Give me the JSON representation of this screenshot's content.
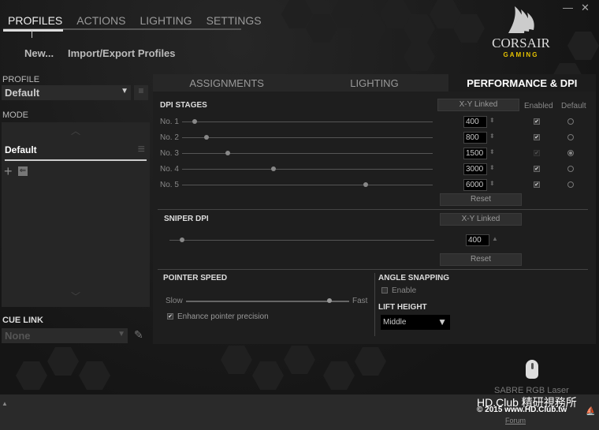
{
  "nav": {
    "tabs": [
      "PROFILES",
      "ACTIONS",
      "LIGHTING",
      "SETTINGS"
    ],
    "active": "PROFILES"
  },
  "window": {
    "minimize": "—",
    "close": "✕"
  },
  "brand": {
    "name": "CORSAIR",
    "sub": "GAMING",
    "accent": "#e6c200"
  },
  "actions": {
    "new": "New...",
    "import_export": "Import/Export Profiles"
  },
  "profile": {
    "label": "PROFILE",
    "value": "Default"
  },
  "mode": {
    "label": "MODE",
    "items": [
      "Default"
    ]
  },
  "cue_link": {
    "label": "CUE LINK",
    "value": "None"
  },
  "tabs": {
    "items": [
      "ASSIGNMENTS",
      "LIGHTING",
      "PERFORMANCE & DPI"
    ],
    "active": 2
  },
  "dpi": {
    "title": "DPI STAGES",
    "xy_linked": "X-Y Linked",
    "enabled_label": "Enabled",
    "default_label": "Default",
    "reset": "Reset",
    "range_max": 8200,
    "stages": [
      {
        "label": "No. 1",
        "value": "400",
        "enabled": true,
        "default": false
      },
      {
        "label": "No. 2",
        "value": "800",
        "enabled": true,
        "default": false
      },
      {
        "label": "No. 3",
        "value": "1500",
        "enabled": true,
        "disabled": true,
        "default": true
      },
      {
        "label": "No. 4",
        "value": "3000",
        "enabled": true,
        "default": false
      },
      {
        "label": "No. 5",
        "value": "6000",
        "enabled": true,
        "default": false
      }
    ]
  },
  "sniper": {
    "title": "SNIPER DPI",
    "xy_linked": "X-Y Linked",
    "value": "400",
    "reset": "Reset"
  },
  "pointer": {
    "title": "POINTER SPEED",
    "slow": "Slow",
    "fast": "Fast",
    "level_percent": 88,
    "enhance": "Enhance pointer precision",
    "enhance_checked": true
  },
  "angle": {
    "title": "ANGLE SNAPPING",
    "enable": "Enable",
    "checked": false
  },
  "lift": {
    "title": "LIFT HEIGHT",
    "value": "Middle"
  },
  "device": {
    "name": "SABRE RGB Laser",
    "forum": "Forum"
  },
  "watermark": {
    "line1": "HD.Club 精研視務所",
    "line2": "© 2015  www.HD.Club.tw"
  }
}
